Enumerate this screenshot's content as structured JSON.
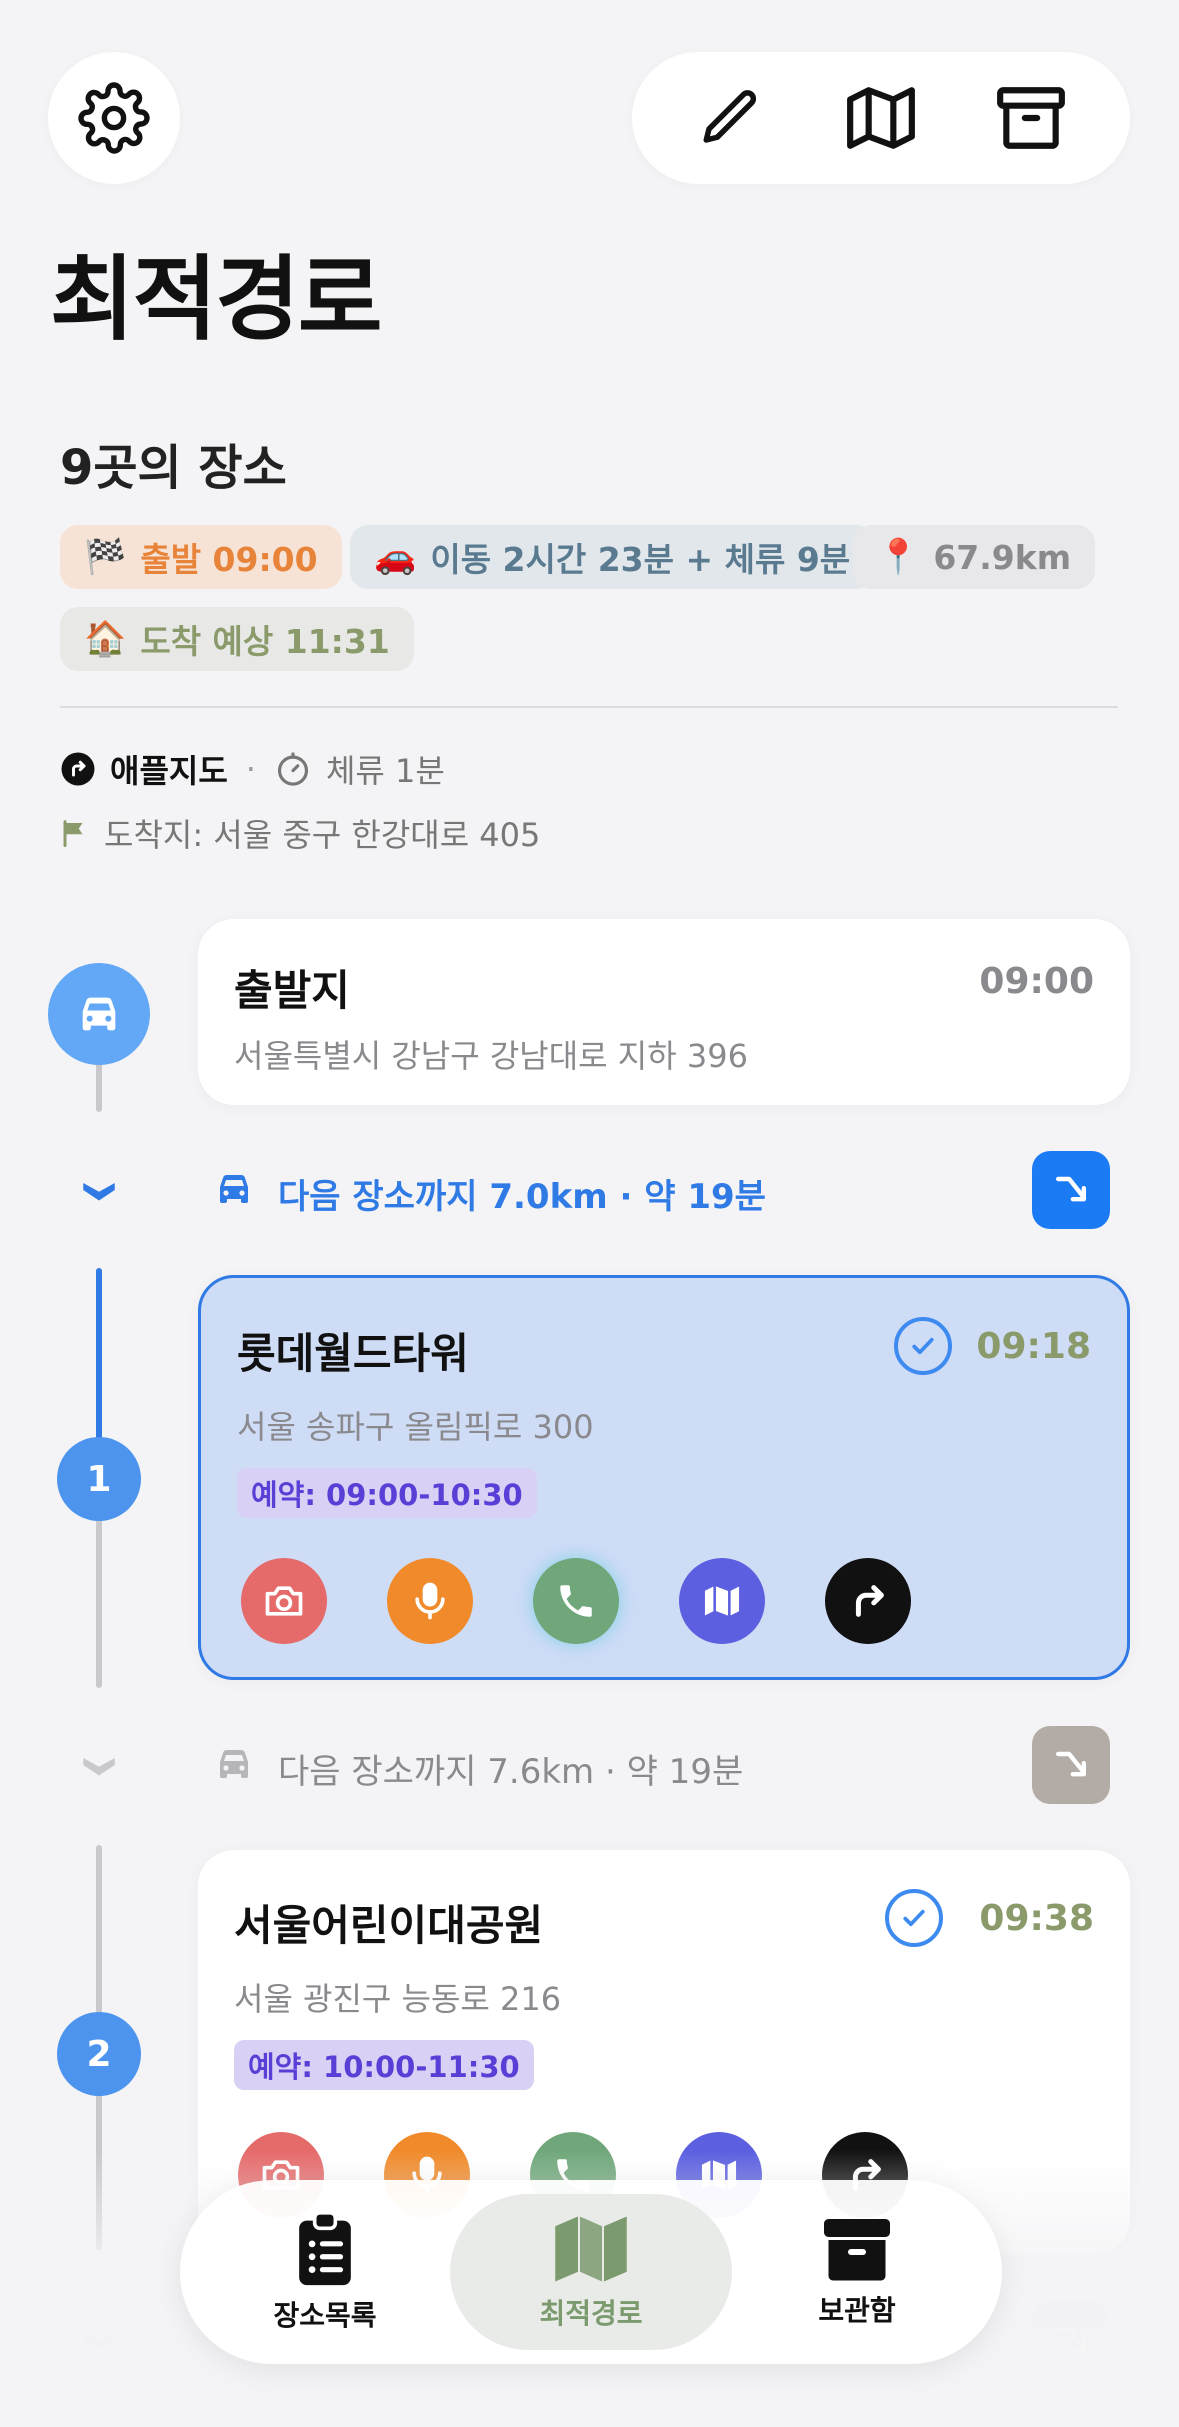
{
  "header": {
    "title": "최적경로",
    "place_count": "9곳의 장소"
  },
  "summary_chips": [
    {
      "emoji": "🏁",
      "text": "출발 09:00",
      "color": "#e8843a",
      "bg": "#f6e3d6"
    },
    {
      "emoji": "🚗",
      "text": "이동 2시간 23분 + 체류 9분",
      "color": "#5a7a90",
      "bg": "#e2e7ec"
    },
    {
      "emoji": "📍",
      "text": "67.9km",
      "color": "#8a8a8e",
      "bg": "#e8e8ea"
    },
    {
      "emoji": "🏠",
      "text": "도착 예상 11:31",
      "color": "#8a9a6a",
      "bg": "#e8e9e6"
    }
  ],
  "meta": {
    "map_app": "애플지도",
    "separator": "·",
    "stay": "체류 1분",
    "destination": "도착지: 서울 중구 한강대로 405"
  },
  "start": {
    "name": "출발지",
    "time": "09:00",
    "address": "서울특별시 강남구 강남대로 지하 396"
  },
  "legs": [
    {
      "text": "다음 장소까지 7.0km · 약 19분"
    },
    {
      "text": "다음 장소까지 7.6km · 약 19분"
    }
  ],
  "stops": [
    {
      "number": "1",
      "name": "롯데월드타워",
      "time": "09:18",
      "address": "서울 송파구 올림픽로 300",
      "reservation": "예약: 09:00-10:30"
    },
    {
      "number": "2",
      "name": "서울어린이대공원",
      "time": "09:38",
      "address": "서울 광진구 능동로 216",
      "reservation": "예약: 10:00-11:30"
    }
  ],
  "tabs": [
    {
      "label": "장소목록"
    },
    {
      "label": "최적경로"
    },
    {
      "label": "보관함"
    }
  ],
  "colors": {
    "accent_blue": "#2f7ae5",
    "time_green": "#8a9a6a",
    "camera": "#e56a6a",
    "mic": "#f08a2a",
    "phone": "#6fa77a",
    "map": "#5b5fe0",
    "route": "#111111"
  }
}
